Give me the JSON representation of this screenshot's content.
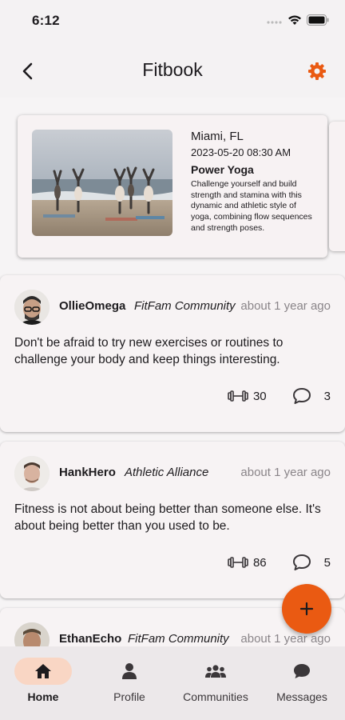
{
  "status": {
    "time": "6:12"
  },
  "app_bar": {
    "title": "Fitbook",
    "back_icon": "back-arrow-icon",
    "settings_icon": "gear-icon"
  },
  "event": {
    "location": "Miami, FL",
    "datetime": "2023-05-20 08:30 AM",
    "title": "Power Yoga",
    "description": "Challenge yourself and build strength and stamina with this dynamic and athletic style of yoga, combining flow sequences and strength poses."
  },
  "posts": [
    {
      "author": "OllieOmega",
      "community": "FitFam Community",
      "time": "about 1 year ago",
      "text": "Don't be afraid to try new exercises or routines to challenge your body and keep things interesting.",
      "likes": "30",
      "comments": "3"
    },
    {
      "author": "HankHero",
      "community": "Athletic Alliance",
      "time": "about 1 year ago",
      "text": "Fitness is not about being better than someone else. It's about being better than you used to be.",
      "likes": "86",
      "comments": "5"
    },
    {
      "author": "EthanEcho",
      "community": "FitFam Community",
      "time": "about 1 year ago"
    }
  ],
  "nav": {
    "items": [
      {
        "label": "Home",
        "icon": "home-icon"
      },
      {
        "label": "Profile",
        "icon": "person-icon"
      },
      {
        "label": "Communities",
        "icon": "group-icon"
      },
      {
        "label": "Messages",
        "icon": "chat-icon"
      }
    ],
    "active": "Home"
  },
  "colors": {
    "accent": "#ea5a12",
    "active_pill": "#f9d6c4",
    "background": "#f4f2f3"
  }
}
